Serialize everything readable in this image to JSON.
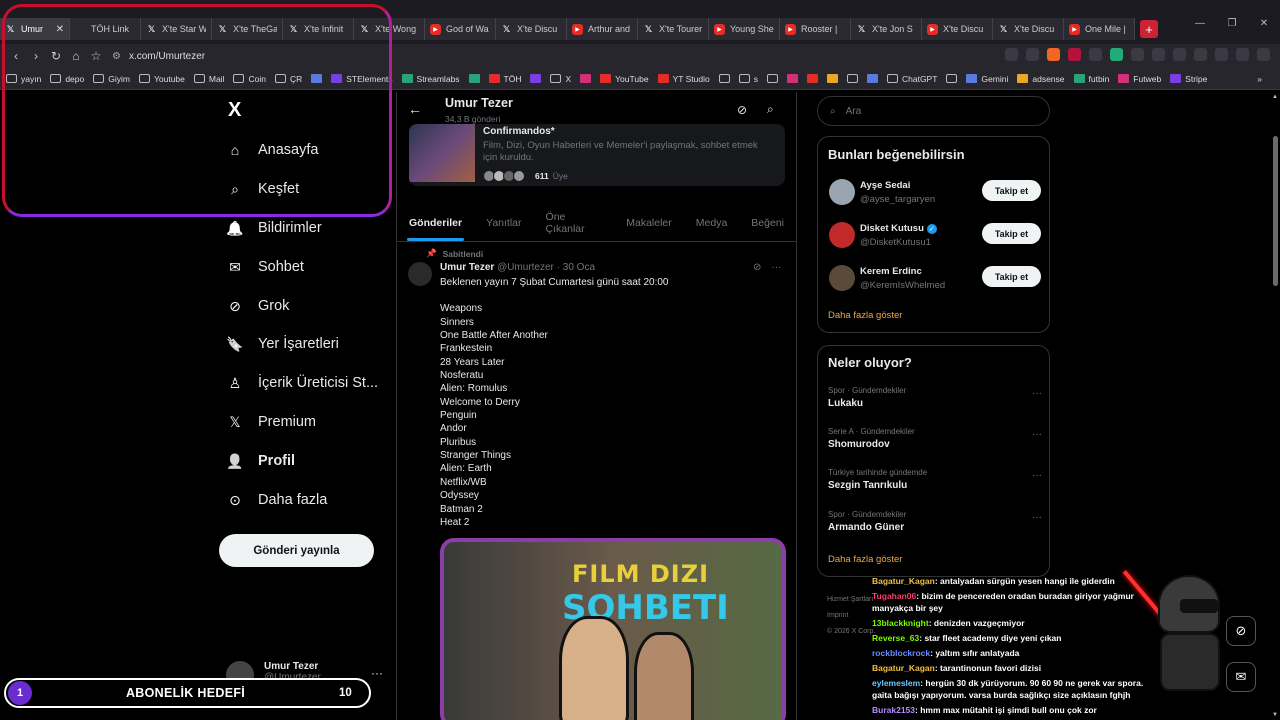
{
  "browser": {
    "tabs": [
      {
        "title": "Umur",
        "icon": "x",
        "active": true
      },
      {
        "title": "TÖH Link",
        "icon": "red"
      },
      {
        "title": "X'te Star W",
        "icon": "x"
      },
      {
        "title": "X'te TheGa",
        "icon": "x"
      },
      {
        "title": "X'te Infinit",
        "icon": "x"
      },
      {
        "title": "X'te Wong",
        "icon": "x"
      },
      {
        "title": "God of Wa",
        "icon": "yt"
      },
      {
        "title": "X'te Discu",
        "icon": "x"
      },
      {
        "title": "Arthur and",
        "icon": "yt"
      },
      {
        "title": "X'te Tourer",
        "icon": "x"
      },
      {
        "title": "Young She",
        "icon": "yt"
      },
      {
        "title": "Rooster |",
        "icon": "yt"
      },
      {
        "title": "X'te Jon S",
        "icon": "x"
      },
      {
        "title": "X'te Discu",
        "icon": "yt"
      },
      {
        "title": "X'te Discu",
        "icon": "x"
      },
      {
        "title": "One Mile |",
        "icon": "yt"
      }
    ],
    "new_tab": "+",
    "url": "x.com/Umurtezer",
    "bookmarks": [
      {
        "label": "yayın",
        "kind": "folder"
      },
      {
        "label": "depo",
        "kind": "folder"
      },
      {
        "label": "Giyim",
        "kind": "folder"
      },
      {
        "label": "Youtube",
        "kind": "folder"
      },
      {
        "label": "Mail",
        "kind": "folder"
      },
      {
        "label": "Coin",
        "kind": "folder"
      },
      {
        "label": "ÇR",
        "kind": "folder"
      },
      {
        "label": "",
        "kind": "bl"
      },
      {
        "label": "STElements",
        "kind": "pu"
      },
      {
        "label": "Streamlabs",
        "kind": "gr"
      },
      {
        "label": "",
        "kind": "gr"
      },
      {
        "label": "TÖH",
        "kind": "rd"
      },
      {
        "label": "",
        "kind": "pu"
      },
      {
        "label": "X",
        "kind": "folder"
      },
      {
        "label": "",
        "kind": "pk"
      },
      {
        "label": "YouTube",
        "kind": "rd"
      },
      {
        "label": "YT Studio",
        "kind": "rd"
      },
      {
        "label": "",
        "kind": "folder"
      },
      {
        "label": "s",
        "kind": "folder"
      },
      {
        "label": "",
        "kind": "folder"
      },
      {
        "label": "",
        "kind": "pk"
      },
      {
        "label": "",
        "kind": "rd"
      },
      {
        "label": "",
        "kind": "yl"
      },
      {
        "label": "",
        "kind": "folder"
      },
      {
        "label": "",
        "kind": "bl"
      },
      {
        "label": "ChatGPT",
        "kind": "folder"
      },
      {
        "label": "",
        "kind": "folder"
      },
      {
        "label": "Gemini",
        "kind": "bl"
      },
      {
        "label": "adsense",
        "kind": "yl"
      },
      {
        "label": "futbin",
        "kind": "gr"
      },
      {
        "label": "Futweb",
        "kind": "pk"
      },
      {
        "label": "Stripe",
        "kind": "pu"
      }
    ]
  },
  "leftnav": {
    "logo": "X",
    "items": [
      {
        "label": "Anasayfa",
        "icon": "home-icon"
      },
      {
        "label": "Keşfet",
        "icon": "search-icon"
      },
      {
        "label": "Bildirimler",
        "icon": "bell-icon"
      },
      {
        "label": "Sohbet",
        "icon": "mail-icon"
      },
      {
        "label": "Grok",
        "icon": "grok-icon"
      },
      {
        "label": "Yer İşaretleri",
        "icon": "bookmark-icon"
      },
      {
        "label": "İçerik Üreticisi St...",
        "icon": "creator-icon"
      },
      {
        "label": "Premium",
        "icon": "x-premium-icon"
      },
      {
        "label": "Profil",
        "icon": "person-icon",
        "bold": true
      },
      {
        "label": "Daha fazla",
        "icon": "more-circle-icon"
      }
    ],
    "post_button": "Gönderi yayınla",
    "account": {
      "name": "Umur Tezer",
      "handle": "@Umurtezer"
    }
  },
  "profile": {
    "name": "Umur Tezer",
    "posts": "34,3 B gönderi",
    "community": {
      "title": "Confirmandos*",
      "description": "Film, Dizi, Oyun Haberleri ve Memeler'i paylaşmak, sohbet etmek için kuruldu.",
      "members_count": "611",
      "members_label": "Üye"
    },
    "tabs": [
      "Gönderiler",
      "Yanıtlar",
      "Öne Çıkanlar",
      "Makaleler",
      "Medya",
      "Beğeni"
    ],
    "active_tab": 0
  },
  "tweet": {
    "pinned_label": "Sabitlendi",
    "author": "Umur Tezer",
    "handle": "@Umurtezer",
    "date": "· 30 Oca",
    "intro": "Beklenen yayın 7 Şubat Cumartesi günü saat 20:00",
    "list": [
      "Weapons",
      "Sinners",
      "One Battle After Another",
      "Frankestein",
      "28 Years Later",
      "Nosferatu",
      "Alien: Romulus",
      "Welcome to Derry",
      "Penguin",
      "Andor",
      "Pluribus",
      "Stranger Things",
      "Alien: Earth",
      "Netflix/WB",
      "Odyssey",
      "Batman 2",
      "Heat 2"
    ],
    "poster_line1": "FILM DIZI",
    "poster_line2": "SOHBETI"
  },
  "right": {
    "search_placeholder": "Ara",
    "suggest_title": "Bunları beğenebilirsin",
    "suggestions": [
      {
        "name": "Ayşe Sedai",
        "handle": "@ayse_targaryen",
        "verified": false,
        "button": "Takip et"
      },
      {
        "name": "Disket Kutusu",
        "handle": "@DisketKutusu1",
        "verified": true,
        "button": "Takip et"
      },
      {
        "name": "Kerem Erdinc",
        "handle": "@KeremIsWhelmed",
        "verified": false,
        "button": "Takip et"
      }
    ],
    "show_more": "Daha fazla göster",
    "trends_title": "Neler oluyor?",
    "trends": [
      {
        "category": "Spor · Gündemdekiler",
        "title": "Lukaku"
      },
      {
        "category": "Serie A · Gündemdekiler",
        "title": "Shomurodov"
      },
      {
        "category": "Türkiye tarihinde gündemde",
        "title": "Sezgin Tanrıkulu"
      },
      {
        "category": "Spor · Gündemdekiler",
        "title": "Armando Güner"
      }
    ],
    "show_more_2": "Daha fazla göster",
    "footer_1": "Hizmet Şartları",
    "footer_2": "Imprint",
    "footer_3": "© 2026 X Corp."
  },
  "overlay": {
    "goal_current": "1",
    "goal_label": "ABONELİK HEDEFİ",
    "goal_target": "10",
    "chat": [
      {
        "user": "Bagatur_Kagan",
        "color": "#f0c040",
        "text": ": antalyadan sürgün yesen hangi ile giderdin"
      },
      {
        "user": "Tugahan06",
        "color": "#ff3b6b",
        "text": ": bizim de pencereden oradan buradan giriyor yağmur manyakça bir şey"
      },
      {
        "user": "13blackknight",
        "color": "#7cfc00",
        "text": ": denizden vazgeçmiyor"
      },
      {
        "user": "Reverse_63",
        "color": "#7cfc00",
        "text": ": star fleet academy diye yeni çıkan"
      },
      {
        "user": "rockblockrock",
        "color": "#6a8cff",
        "text": ": yaltım sıfır anlatyada"
      },
      {
        "user": "Bagatur_Kagan",
        "color": "#f0c040",
        "text": ": tarantinonun favori dizisi"
      },
      {
        "user": "eylemeslem",
        "color": "#6ac8ff",
        "text": ": hergün 30 dk yürüyorum. 90 60 90 ne gerek var spora. gaita bağışı yapıyorum. varsa burda sağlıkçı size açıklasın fghjh"
      },
      {
        "user": "Burak2153",
        "color": "#b48cff",
        "text": ": hmm max mütahit işi şimdi bull onu çok zor"
      }
    ]
  },
  "colors": {
    "accent": "#1d9bf0",
    "goal": "#6a2bd1",
    "highlight": "#c8102e"
  }
}
